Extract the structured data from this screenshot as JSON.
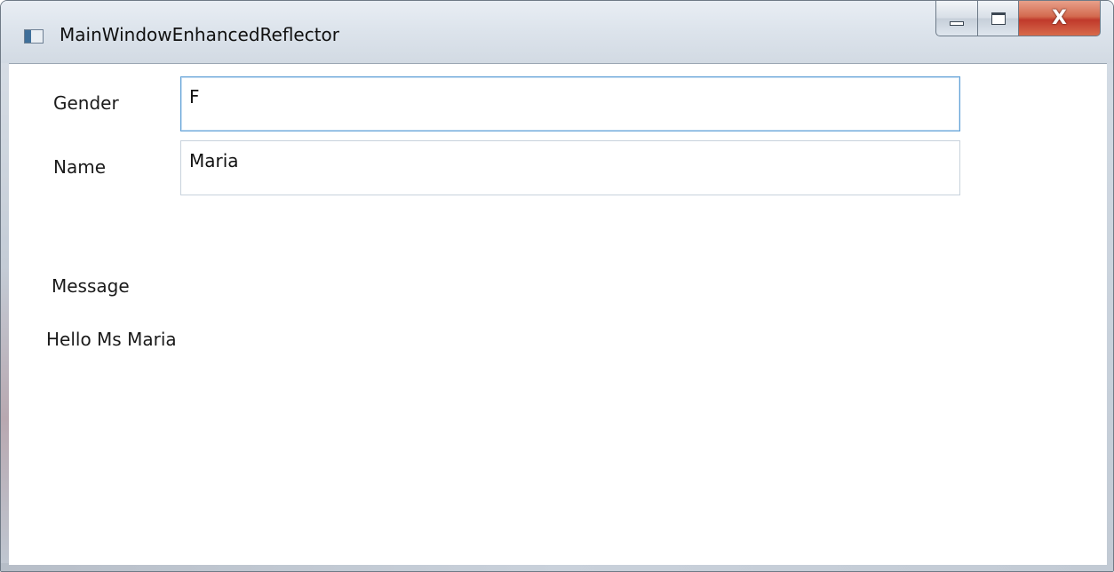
{
  "window": {
    "title": "MainWindowEnhancedReflector",
    "app_icon": "window-app-icon",
    "buttons": {
      "minimize_icon": "minimize-icon",
      "maximize_icon": "maximize-icon",
      "close_icon": "close-icon",
      "close_glyph": "X"
    },
    "colors": {
      "close_button": "#c0392b",
      "focus_border": "#5e9fd6"
    }
  },
  "form": {
    "gender": {
      "label": "Gender",
      "value": "F"
    },
    "name": {
      "label": "Name",
      "value": "Maria"
    },
    "message": {
      "label": "Message",
      "value": "Hello Ms Maria"
    }
  }
}
